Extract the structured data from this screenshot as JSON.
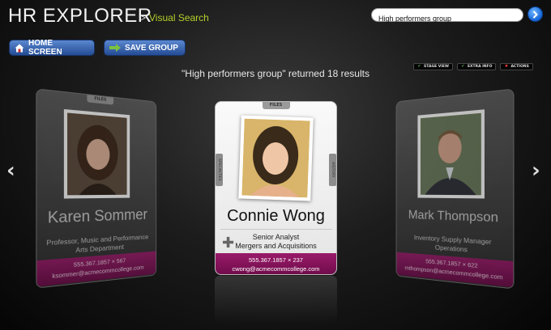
{
  "header": {
    "app_title": "HR EXPLORER",
    "separator": ">",
    "subtitle": "Visual Search"
  },
  "search": {
    "value": "High performers group",
    "go_icon": "arrow-right-circle-icon"
  },
  "toolbar": {
    "home_label": "HOME SCREEN",
    "save_label": "SAVE GROUP"
  },
  "view_toggles": [
    {
      "label": "STAGE VIEW",
      "mark": "✔",
      "mark_color": "#4caf50"
    },
    {
      "label": "EXTRA INFO",
      "mark": "✔",
      "mark_color": "#4caf50"
    },
    {
      "label": "ACTIONS",
      "mark": "✖",
      "mark_color": "#e53935"
    }
  ],
  "results_text": "\"High performers group\" returned 18 results",
  "nav": {
    "prev": "‹",
    "next": "›"
  },
  "card_tabs": {
    "top": "FILES",
    "left": "SPECIALTIES",
    "right": "HISTORY"
  },
  "cards": {
    "left": {
      "name": "Karen Sommer",
      "title": "Professor, Music and Performance",
      "department": "Arts Department",
      "phone": "555.367.1857 × 567",
      "email": "ksommer@acmecommcollege.com"
    },
    "center": {
      "name": "Connie Wong",
      "title": "Senior Analyst",
      "department": "Mergers and Acquisitions",
      "phone": "555.367.1857 × 237",
      "email": "cwong@acmecommcollege.com"
    },
    "right": {
      "name": "Mark Thompson",
      "title": "Inventory Supply Manager",
      "department": "Operations",
      "phone": "555.367.1857 × 622",
      "email": "mthompson@acmecommcollege.com"
    }
  },
  "colors": {
    "accent_green": "#b6cf2a",
    "button_blue": "#3a6ab4",
    "contact_magenta": "#8a1560"
  }
}
